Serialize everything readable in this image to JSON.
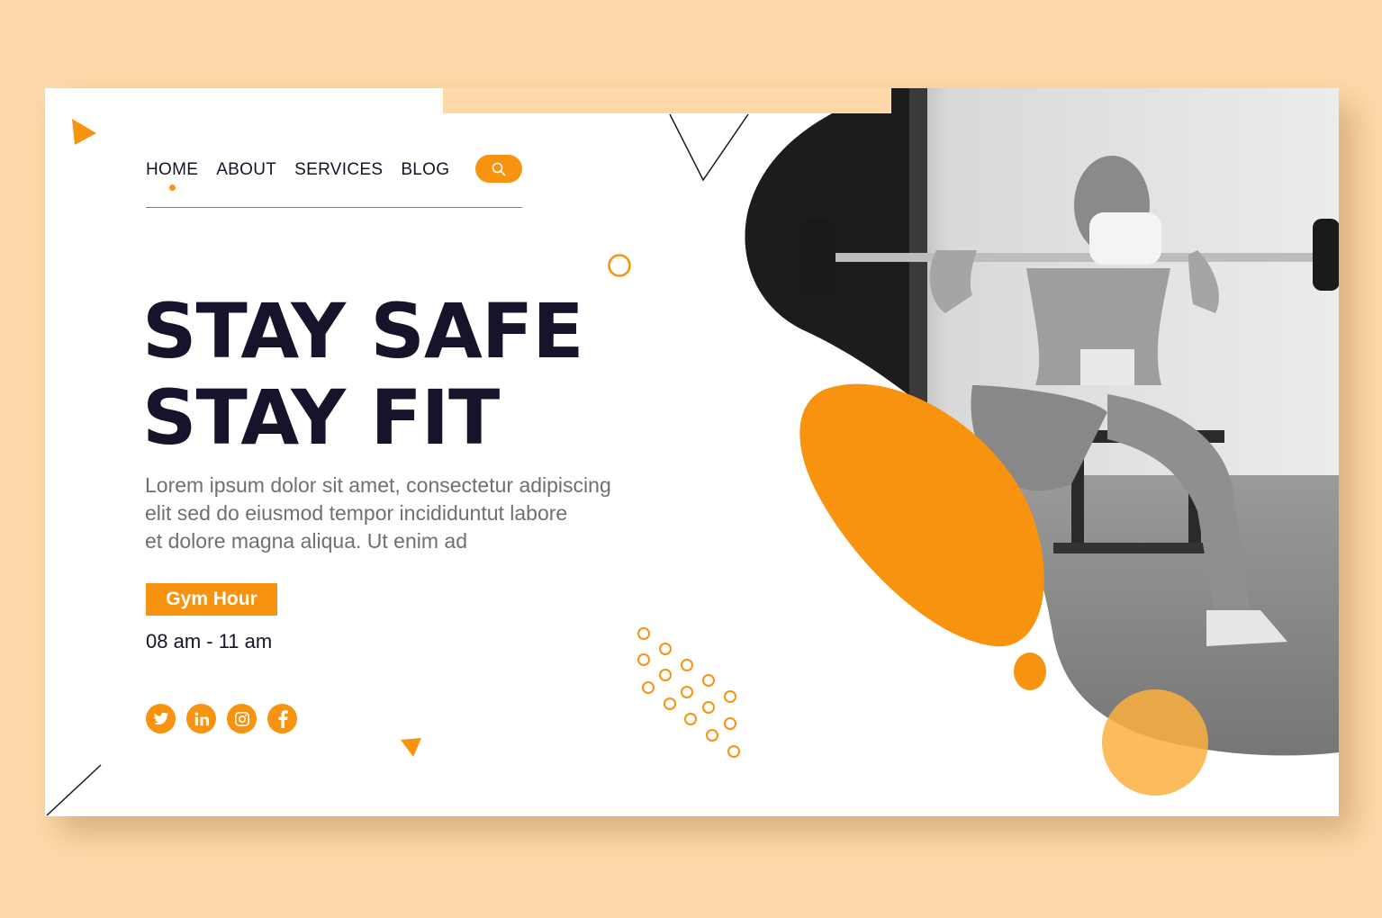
{
  "nav": {
    "items": [
      "HOME",
      "ABOUT",
      "SERVICES",
      "BLOG"
    ],
    "active": "HOME",
    "search_icon": "search-icon"
  },
  "hero": {
    "headline_line1": "STAY SAFE",
    "headline_line2": "STAY FIT",
    "body_line1": "Lorem ipsum dolor sit amet, consectetur adipiscing",
    "body_line2": "elit sed do eiusmod tempor incididuntut labore",
    "body_line3": "et dolore magna aliqua. Ut enim ad"
  },
  "gym": {
    "badge": "Gym Hour",
    "hours": "08 am - 11 am"
  },
  "socials": [
    "twitter-icon",
    "linkedin-icon",
    "instagram-icon",
    "facebook-icon"
  ],
  "colors": {
    "accent": "#f7930f",
    "background": "#fdd9a9",
    "text_dark": "#16142a",
    "text_muted": "#6f6f74"
  }
}
